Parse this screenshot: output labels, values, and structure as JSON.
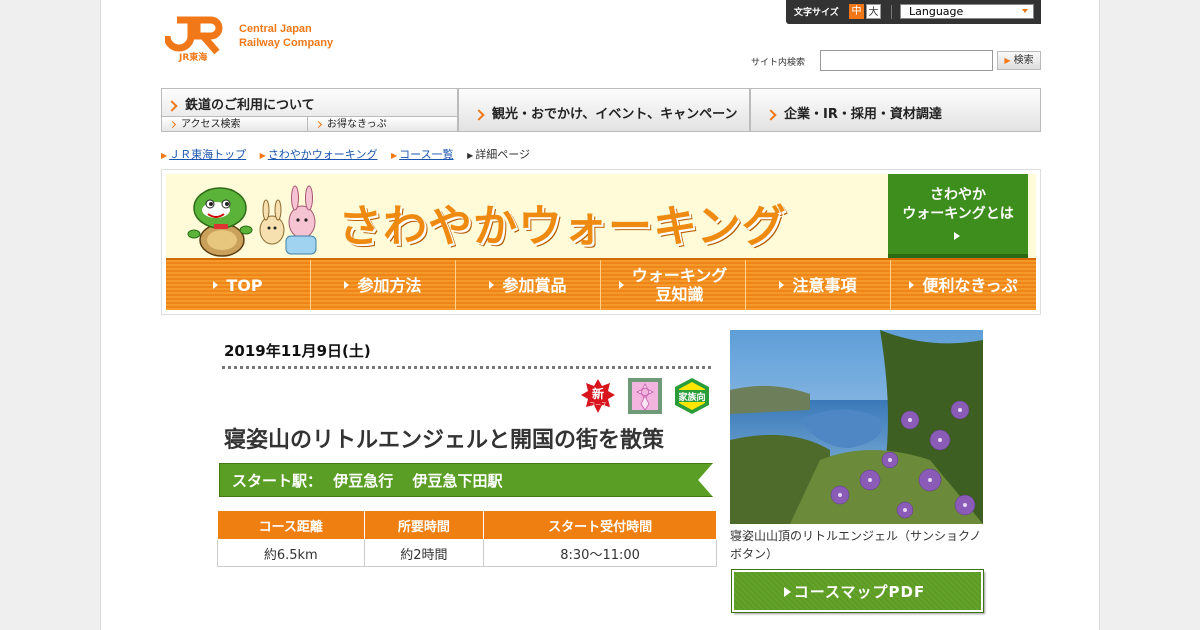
{
  "header": {
    "logo_line1": "Central Japan",
    "logo_line2": "Railway Company",
    "logo_mark_text": "JR東海",
    "font_size_label": "文字サイズ",
    "font_size_mid": "中",
    "font_size_big": "大",
    "language_label": "Language",
    "search_label": "サイト内検索",
    "search_value": "",
    "search_button": "検索"
  },
  "global_nav": {
    "rail": "鉄道のご利用について",
    "rail_sub1": "アクセス検索",
    "rail_sub2": "お得なきっぷ",
    "tour": "観光・おでかけ、イベント、キャンペーン",
    "corp": "企業・IR・採用・資材調達"
  },
  "breadcrumb": {
    "items": [
      "ＪＲ東海トップ",
      "さわやかウォーキング",
      "コース一覧"
    ],
    "current": "詳細ページ"
  },
  "banner": {
    "title": "さわやかウォーキング",
    "about_line1": "さわやか",
    "about_line2": "ウォーキングとは",
    "nav": [
      {
        "label": "TOP"
      },
      {
        "label": "参加方法"
      },
      {
        "label": "参加賞品"
      },
      {
        "label": "ウォーキング",
        "label2": "豆知識"
      },
      {
        "label": "注意事項"
      },
      {
        "label": "便利なきっぷ"
      }
    ]
  },
  "event": {
    "date": "2019年11月9日(土)",
    "badges": {
      "new_text": "新",
      "new_sub": "コース",
      "family_text": "家族向"
    },
    "title": "寝姿山のリトルエンジェルと開国の街を散策",
    "start_label": "スタート駅：",
    "start_line": "伊豆急行",
    "start_station": "伊豆急下田駅",
    "table": {
      "headers": [
        "コース距離",
        "所要時間",
        "スタート受付時間"
      ],
      "values": [
        "約6.5km",
        "約2時間",
        "8:30～11:00"
      ]
    }
  },
  "sidebar": {
    "photo_caption": "寝姿山山頂のリトルエンジェル（サンショクノボタン）",
    "pdf_button": "コースマップPDF"
  },
  "colors": {
    "brand_orange": "#f07818",
    "nav_orange": "#ef8418",
    "green": "#5a9e26"
  }
}
